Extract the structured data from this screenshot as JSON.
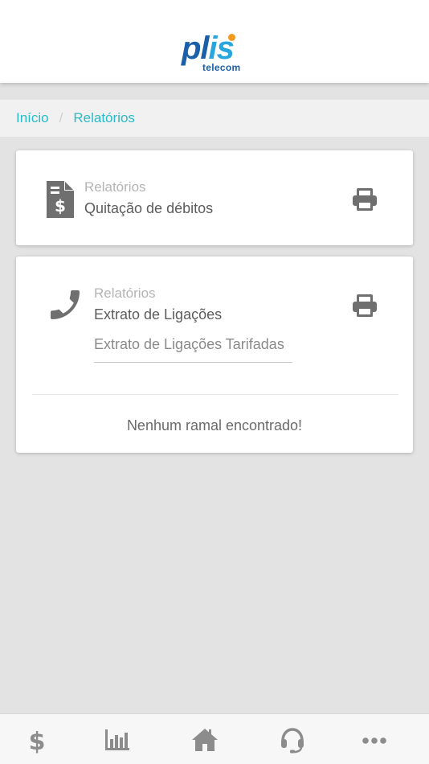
{
  "header": {
    "logo_text_a": "pl",
    "logo_text_b": "is",
    "logo_sub": "telecom"
  },
  "breadcrumb": {
    "home": "Início",
    "separator": "/",
    "current": "Relatórios"
  },
  "cards": [
    {
      "category": "Relatórios",
      "title": "Quitação de débitos",
      "icon": "dollar-document-icon",
      "action_icon": "printer-icon"
    },
    {
      "category": "Relatórios",
      "title": "Extrato de Ligações",
      "icon": "phone-icon",
      "action_icon": "printer-icon",
      "select_value": "Extrato de Ligações Tarifadas",
      "empty_message": "Nenhum ramal encontrado!"
    }
  ],
  "tabbar": {
    "items": [
      "dollar-icon",
      "bar-chart-icon",
      "home-icon",
      "headset-icon",
      "more-dots-icon"
    ]
  },
  "colors": {
    "accent": "#2bbac7",
    "icon_gray": "#6f6f6f",
    "tab_icon_gray": "#8c8c8c",
    "brand_blue": "#1a5fa8",
    "brand_light_blue": "#29a6dd",
    "brand_orange": "#f39a1e"
  }
}
